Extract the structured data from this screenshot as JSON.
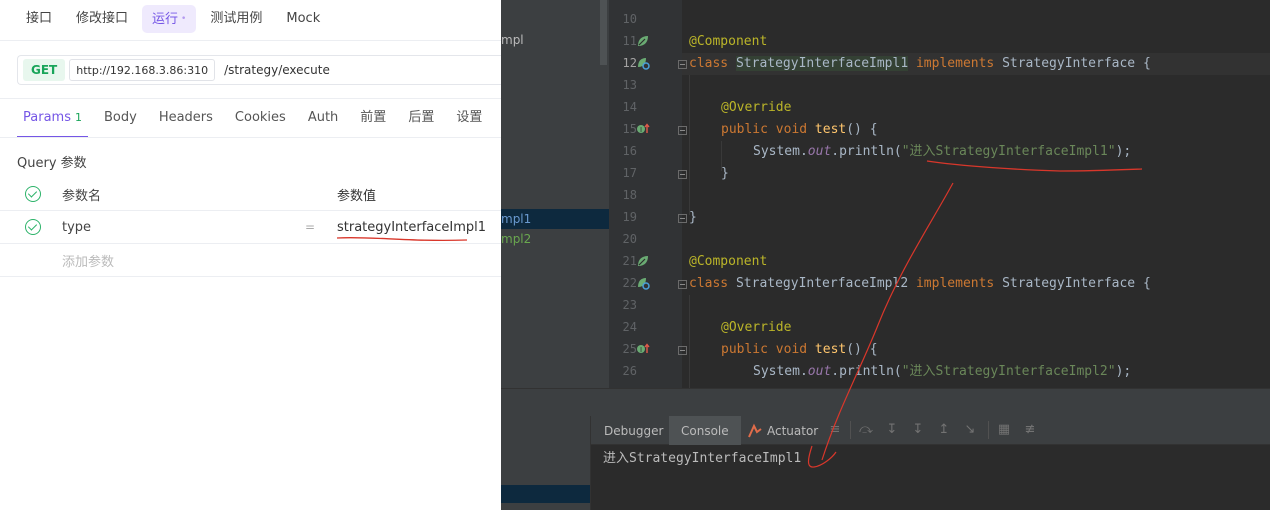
{
  "api": {
    "top_tabs": [
      "接口",
      "修改接口",
      "运行",
      "测试用例",
      "Mock"
    ],
    "active_tab_dot": "•",
    "request": {
      "method": "GET",
      "host": "http://192.168.3.86:310",
      "path": "/strategy/execute"
    },
    "sub_tabs": [
      "Params",
      "Body",
      "Headers",
      "Cookies",
      "Auth",
      "前置",
      "后置",
      "设置"
    ],
    "params_count": "1",
    "query_title": "Query 参数",
    "table_headers": {
      "name": "参数名",
      "value": "参数值"
    },
    "params": [
      {
        "name": "type",
        "value": "strategyInterfaceImpl1"
      }
    ],
    "eq_sign": "=",
    "add_param_placeholder": "添加参数"
  },
  "ide": {
    "project_items": [
      "mpl",
      "mpl1",
      "mpl2"
    ],
    "line_numbers": [
      "10",
      "11",
      "12",
      "13",
      "14",
      "15",
      "16",
      "17",
      "18",
      "19",
      "20",
      "21",
      "22",
      "23",
      "24",
      "25",
      "26"
    ],
    "current_line": "12",
    "code": {
      "l11": "@Component",
      "l12_kw": "class ",
      "l12_name": "StrategyInterfaceImpl1",
      "l12_impl": " implements ",
      "l12_iface": "StrategyInterface {",
      "l14": "@Override",
      "l15_kw": "public void ",
      "l15_fn": "test",
      "l15_rest": "() {",
      "l16_sys": "System.",
      "l16_out": "out",
      "l16_println": ".println(",
      "l16_str": "\"进入StrategyInterfaceImpl1\"",
      "l16_end": ");",
      "l17": "}",
      "l19": "}",
      "l21": "@Component",
      "l22_kw": "class ",
      "l22_name": "StrategyInterfaceImpl2",
      "l22_impl": " implements ",
      "l22_iface": "StrategyInterface {",
      "l24": "@Override",
      "l25_kw": "public void ",
      "l25_fn": "test",
      "l25_rest": "() {",
      "l26_sys": "System.",
      "l26_out": "out",
      "l26_println": ".println(",
      "l26_str": "\"进入StrategyInterfaceImpl2\"",
      "l26_end": ");"
    },
    "tool_tabs": {
      "debugger": "Debugger",
      "console": "Console",
      "actuator": "Actuator"
    },
    "active_tool_tab": "Console",
    "console_output": "进入StrategyInterfaceImpl1"
  },
  "colors": {
    "accent_purple": "#7556e6",
    "get_green": "#19a55a",
    "ide_bg": "#2b2b2b",
    "annotation_red": "#d9372b"
  }
}
